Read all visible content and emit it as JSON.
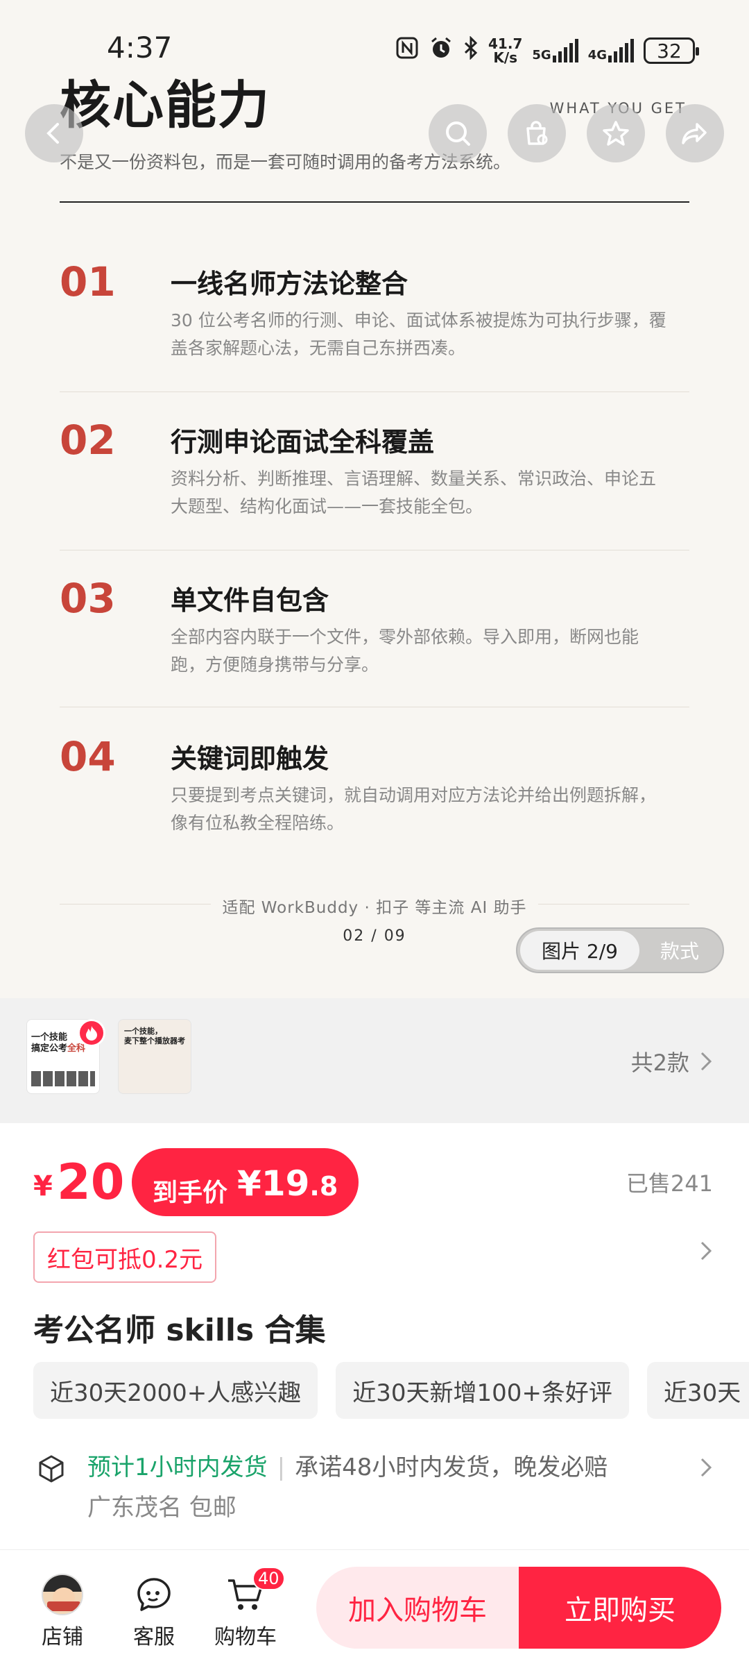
{
  "status_bar": {
    "time": "4:37",
    "net_speed_top": "41.7",
    "net_speed_bottom": "K/s",
    "sim1": "5G",
    "sim2": "4G",
    "battery": "32"
  },
  "hero": {
    "title": "核心能力",
    "subtitle_en": "WHAT YOU GET",
    "subtitle": "不是又一份资料包，而是一套可随时调用的备考方法系统。",
    "features": [
      {
        "num": "01",
        "title": "一线名师方法论整合",
        "desc": "30 位公考名师的行测、申论、面试体系被提炼为可执行步骤，覆盖各家解题心法，无需自己东拼西凑。"
      },
      {
        "num": "02",
        "title": "行测申论面试全科覆盖",
        "desc": "资料分析、判断推理、言语理解、数量关系、常识政治、申论五大题型、结构化面试——一套技能全包。"
      },
      {
        "num": "03",
        "title": "单文件自包含",
        "desc": "全部内容内联于一个文件，零外部依赖。导入即用，断网也能跑，方便随身携带与分享。"
      },
      {
        "num": "04",
        "title": "关键词即触发",
        "desc": "只要提到考点关键词，就自动调用对应方法论并给出例题拆解，像有位私教全程陪练。"
      }
    ],
    "compat": "适配 WorkBuddy · 扣子 等主流 AI 助手",
    "pager": "02 / 09",
    "toggle_active": "图片 2/9",
    "toggle_inactive": "款式"
  },
  "variants": {
    "thumb1_line1": "一个技能",
    "thumb1_line2a": "搞定公考",
    "thumb1_line2b": "全科",
    "thumb2_line1": "一个技能，",
    "thumb2_line2": "麦下整个播放器考",
    "count_label": "共2款"
  },
  "price": {
    "symbol": "¥",
    "value": "20",
    "final_label": "到手价",
    "final_symbol": "¥",
    "final_int": "19",
    "final_dec": ".8",
    "sold": "已售241",
    "coupon": "红包可抵0.2元"
  },
  "product": {
    "title": "考公名师 skills 合集",
    "tags": [
      "近30天2000+人感兴趣",
      "近30天新增100+条好评",
      "近30天"
    ]
  },
  "shipping": {
    "highlight": "预计1小时内发货",
    "promise": "承诺48小时内发货，晚发必赔",
    "location": "广东茂名 包邮"
  },
  "bottom_bar": {
    "store": "店铺",
    "service": "客服",
    "cart": "购物车",
    "cart_count": "40",
    "add_to_cart": "加入购物车",
    "buy_now": "立即购买"
  },
  "colors": {
    "accent": "#ff2442",
    "feature_number": "#c8453a",
    "ship_green": "#1aa36a"
  }
}
